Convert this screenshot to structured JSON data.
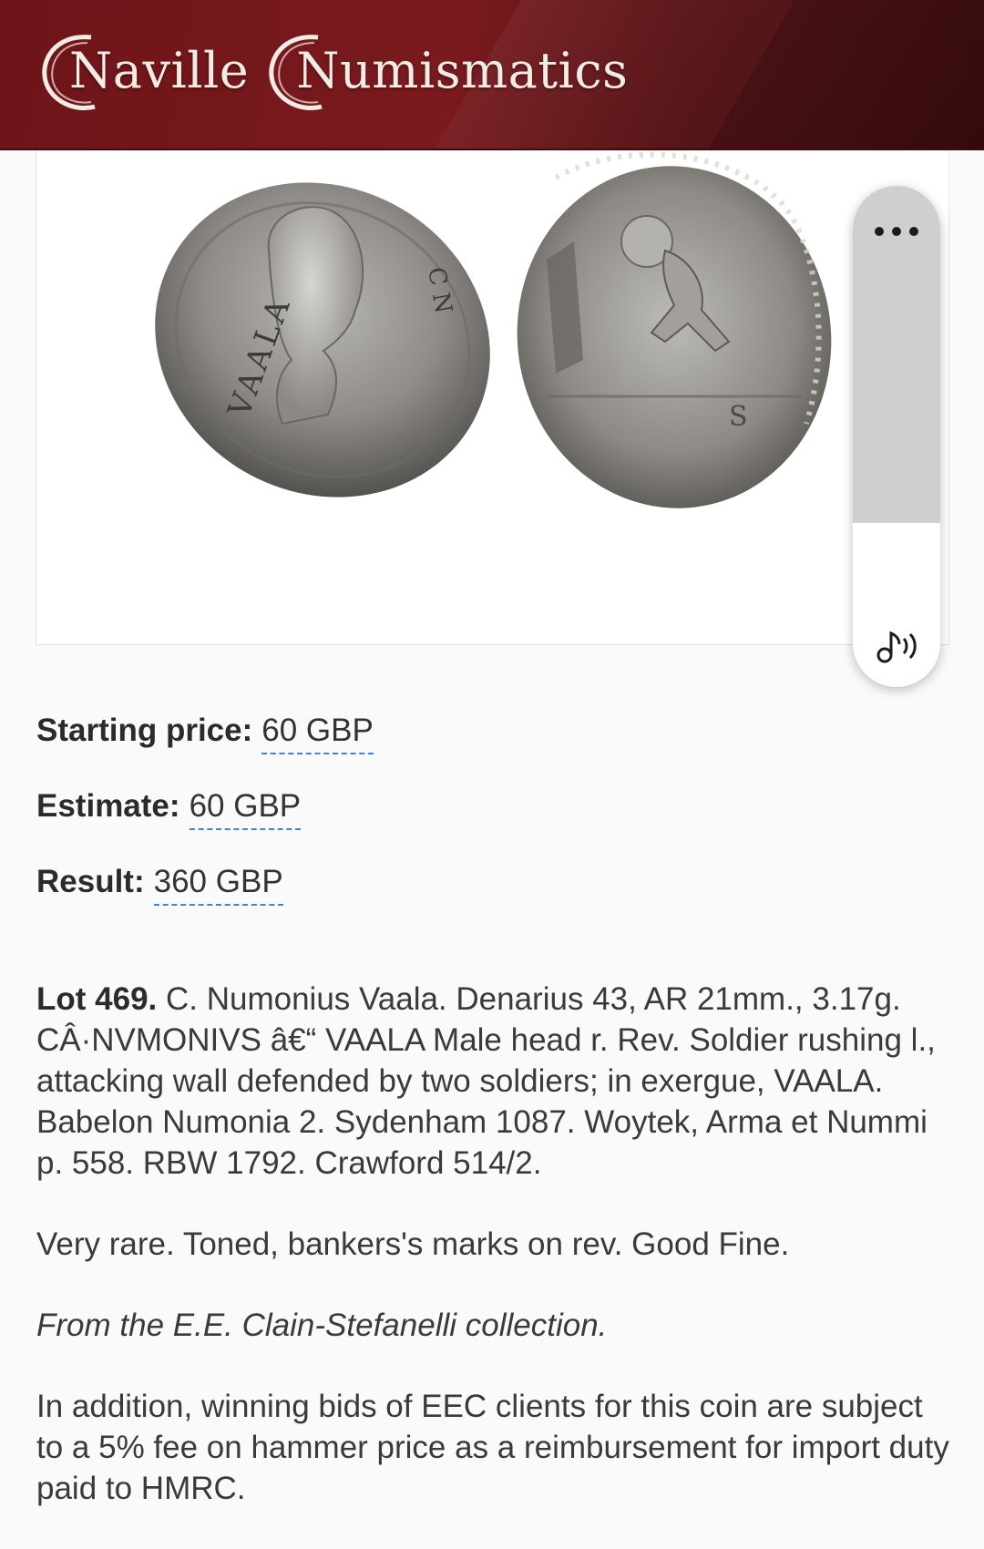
{
  "header": {
    "brand_first": "Naville",
    "brand_second": "Numismatics",
    "brand_color": "#7a1a1e"
  },
  "images": {
    "obverse_legend": "VAALA",
    "obverse_legend_right": "C N",
    "obverse_alt": "Obverse: male head right",
    "reverse_alt": "Reverse: soldier attacking wall"
  },
  "side_panel": {
    "more_icon": "more-horizontal-icon",
    "audio_icon": "audio-speaker-icon"
  },
  "prices": {
    "starting_label": "Starting price:",
    "starting_value": "60 GBP",
    "estimate_label": "Estimate:",
    "estimate_value": "60 GBP",
    "result_label": "Result:",
    "result_value": "360 GBP",
    "link_color": "#4a7fd6"
  },
  "description": {
    "lot_label": "Lot 469.",
    "main_text": "C. Numonius Vaala. Denarius 43, AR 21mm., 3.17g. CÂ·NVMONIVS â€“ VAALA Male head r. Rev. Soldier rushing l., attacking wall defended by two soldiers; in exergue, VAALA. Babelon Numonia 2. Sydenham 1087. Woytek, Arma et Nummi p. 558. RBW 1792. Crawford 514/2.",
    "condition": "Very rare. Toned, bankers's marks on rev. Good Fine.",
    "provenance": "From the E.E. Clain-Stefanelli collection.",
    "fee_note": "In addition, winning bids of EEC clients for this coin are subject to a 5% fee on hammer price as a reimbursement for import duty paid to HMRC."
  }
}
